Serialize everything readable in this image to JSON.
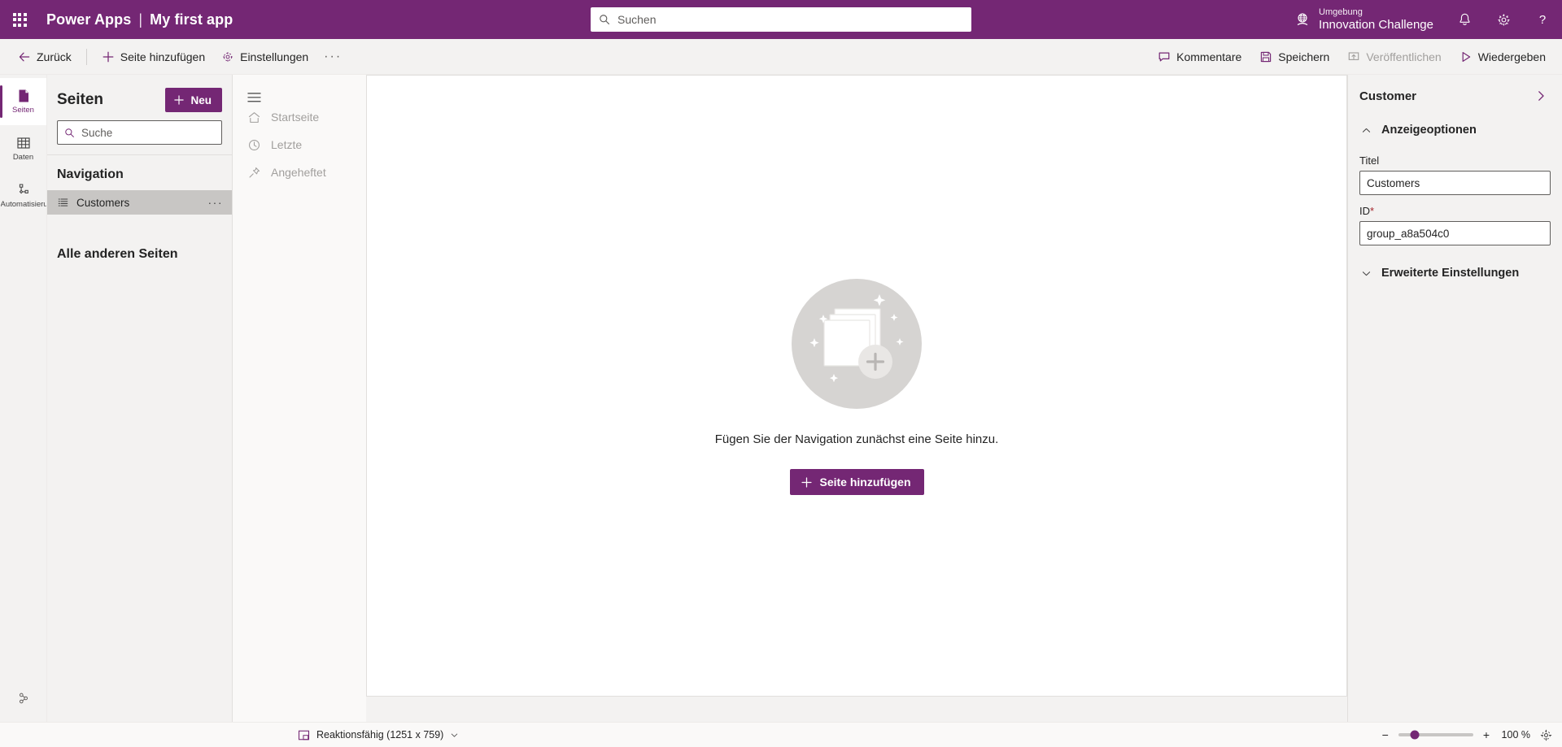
{
  "brand": {
    "waffle_icon": "app-launcher-icon",
    "product": "Power Apps",
    "separator": "|",
    "app_name": "My first app",
    "accent_color": "#742774"
  },
  "search": {
    "placeholder": "Suchen",
    "value": "",
    "icon": "search-icon"
  },
  "environment": {
    "icon": "environment-globe-icon",
    "label": "Umgebung",
    "name": "Innovation Challenge"
  },
  "header_actions": [
    {
      "name": "notifications",
      "icon": "bell-icon"
    },
    {
      "name": "settings",
      "icon": "gear-icon"
    },
    {
      "name": "help",
      "icon": "question-mark-icon"
    }
  ],
  "commandbar": {
    "back": {
      "label": "Zurück",
      "icon": "arrow-left-icon"
    },
    "add_page": {
      "label": "Seite hinzufügen",
      "icon": "plus-icon"
    },
    "settings": {
      "label": "Einstellungen",
      "icon": "gear-icon"
    },
    "overflow": "···",
    "comments": {
      "label": "Kommentare",
      "icon": "comment-icon"
    },
    "save": {
      "label": "Speichern",
      "icon": "save-icon"
    },
    "publish": {
      "label": "Veröffentlichen",
      "icon": "publish-icon",
      "disabled": true
    },
    "play": {
      "label": "Wiedergeben",
      "icon": "play-icon"
    }
  },
  "rail": {
    "items": [
      {
        "label": "Seiten",
        "icon": "page-icon",
        "active": true
      },
      {
        "label": "Daten",
        "icon": "table-icon",
        "active": false
      },
      {
        "label": "Automatisieru",
        "icon": "flow-icon",
        "active": false
      }
    ],
    "bottom": {
      "label": "",
      "icon": "extensions-icon"
    }
  },
  "pages_panel": {
    "title": "Seiten",
    "new_button": {
      "label": "Neu",
      "icon": "plus-icon"
    },
    "search": {
      "placeholder": "Suche",
      "value": "",
      "icon": "search-icon"
    },
    "navigation_group": "Navigation",
    "items": [
      {
        "label": "Customers",
        "icon": "list-icon",
        "selected": true,
        "more": "···"
      }
    ],
    "other_pages_group": "Alle anderen Seiten"
  },
  "nav_preview": {
    "hamburger_icon": "hamburger-icon",
    "items": [
      {
        "label": "Startseite",
        "icon": "home-icon"
      },
      {
        "label": "Letzte",
        "icon": "clock-icon"
      },
      {
        "label": "Angeheftet",
        "icon": "pin-icon"
      }
    ]
  },
  "canvas": {
    "illustration": "empty-pages-illustration",
    "empty_text": "Fügen Sie der Navigation zunächst eine Seite hinzu.",
    "add_page_button": {
      "label": "Seite hinzufügen",
      "icon": "plus-icon"
    }
  },
  "properties": {
    "title": "Customer",
    "collapse_icon": "chevron-right-icon",
    "sections": [
      {
        "label": "Anzeigeoptionen",
        "expanded": true,
        "chevron": "chevron-up-icon",
        "fields": [
          {
            "label": "Titel",
            "value": "Customers",
            "required": false
          },
          {
            "label": "ID",
            "value": "group_a8a504c0",
            "required": true,
            "required_mark": "*"
          }
        ]
      },
      {
        "label": "Erweiterte Einstellungen",
        "expanded": false,
        "chevron": "chevron-down-icon",
        "fields": []
      }
    ]
  },
  "statusbar": {
    "screen_size": {
      "icon": "responsive-icon",
      "label": "Reaktionsfähig (1251 x 759)",
      "chevron": "chevron-down-icon"
    },
    "zoom": {
      "minus": "−",
      "plus": "+",
      "value": "100 %",
      "fit_icon": "fit-to-screen-icon",
      "slider_percent": 22
    }
  }
}
